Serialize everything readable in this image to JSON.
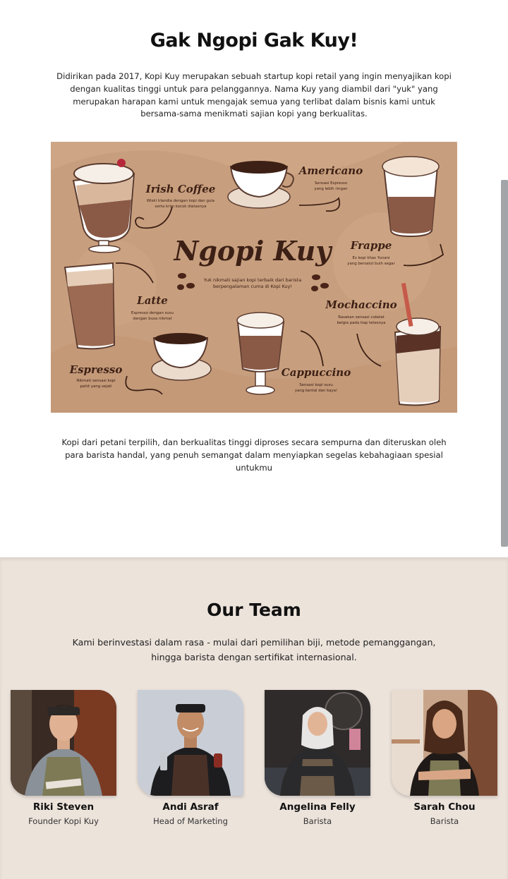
{
  "about": {
    "title": "Gak Ngopi Gak Kuy!",
    "intro": "Didirikan pada 2017, Kopi Kuy merupakan sebuah startup kopi retail yang ingin menyajikan kopi dengan kualitas tinggi untuk para pelanggannya. Nama Kuy yang diambil dari \"yuk\" yang merupakan harapan kami untuk mengajak semua yang terlibat dalam bisnis kami untuk bersama-sama menikmati sajian kopi yang berkualitas.",
    "outro": "Kopi dari petani terpilih, dan berkualitas tinggi diproses secara sempurna dan diteruskan oleh para barista handal, yang penuh semangat dalam menyiapkan segelas kebahagiaan spesial untukmu"
  },
  "menu_board": {
    "title": "Ngopi Kuy",
    "tagline_1": "Yuk nikmati sajian kopi terbaik dari barista",
    "tagline_2": "berpengalaman cuma di Kopi Kuy!",
    "items": [
      {
        "name": "Irish Coffee",
        "desc_1": "Wiski Irlandia dengan kopi dan gula",
        "desc_2": "serta krim kocok diatasnya"
      },
      {
        "name": "Americano",
        "desc_1": "Sensasi Espresso",
        "desc_2": "yang lebih ringan"
      },
      {
        "name": "Frappe",
        "desc_1": "Es kopi khas Yunani",
        "desc_2": "yang bersalut buih segar"
      },
      {
        "name": "Latte",
        "desc_1": "Espresso dengan susu",
        "desc_2": "dengan busa nikmat"
      },
      {
        "name": "Mochaccino",
        "desc_1": "Rasakan sensasi cokelat",
        "desc_2": "belgia pada tiap tetesnya"
      },
      {
        "name": "Espresso",
        "desc_1": "Nikmati sensasi kopi",
        "desc_2": "pahit yang sejati"
      },
      {
        "name": "Cappuccino",
        "desc_1": "Sensasi kopi susu",
        "desc_2": "yang kental dan kaya!"
      }
    ]
  },
  "team": {
    "title": "Our Team",
    "intro": "Kami berinvestasi dalam rasa - mulai dari pemilihan biji, metode pemanggangan, hingga barista dengan sertifikat internasional.",
    "members": [
      {
        "name": "Riki Steven",
        "role": "Founder Kopi Kuy"
      },
      {
        "name": "Andi Asraf",
        "role": "Head of Marketing"
      },
      {
        "name": "Angelina Felly",
        "role": "Barista"
      },
      {
        "name": "Sarah Chou",
        "role": "Barista"
      }
    ]
  },
  "colors": {
    "board_bg": "#c89f7e",
    "board_dark": "#3d2015",
    "team_bg": "#ece3db",
    "apron_green": "#7d7a55",
    "apron_brown": "#4a3128"
  }
}
